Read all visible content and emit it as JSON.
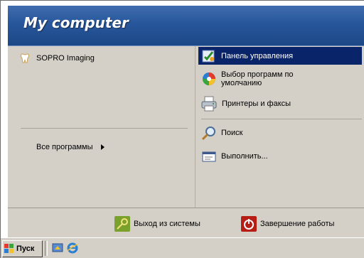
{
  "header": {
    "title": "My computer"
  },
  "left": {
    "programs": [
      {
        "label": "SOPRO Imaging",
        "icon": "tooth-icon"
      }
    ],
    "all_programs": {
      "label": "Все программы",
      "icon": "arrow-right-icon"
    }
  },
  "right": {
    "items": [
      {
        "label": "Панель управления",
        "icon": "control-panel-icon",
        "selected": true
      },
      {
        "label": "Выбор программ по умолчанию",
        "icon": "default-programs-icon"
      },
      {
        "label": "Принтеры и факсы",
        "icon": "printer-icon"
      },
      {
        "label": "Поиск",
        "icon": "search-icon"
      },
      {
        "label": "Выполнить...",
        "icon": "run-icon"
      }
    ]
  },
  "footer": {
    "logoff": {
      "label": "Выход из системы",
      "icon": "key-icon"
    },
    "shutdown": {
      "label": "Завершение работы",
      "icon": "power-icon"
    }
  },
  "taskbar": {
    "start_label": "Пуск",
    "quick_launch": [
      {
        "icon": "show-desktop-icon"
      },
      {
        "icon": "internet-explorer-icon"
      }
    ]
  },
  "colors": {
    "header": "#27569b",
    "selection": "#0a246a",
    "menu_bg": "#d4d0c8"
  }
}
